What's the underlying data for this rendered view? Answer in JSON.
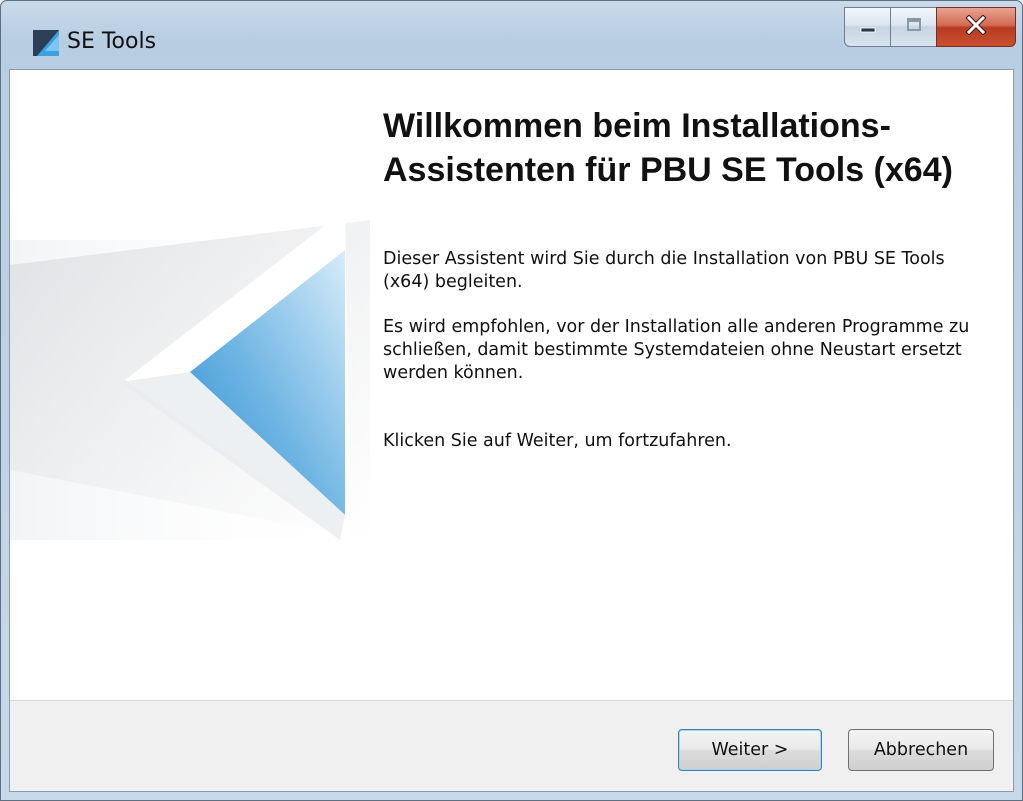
{
  "window": {
    "title": "SE Tools"
  },
  "content": {
    "heading": "Willkommen beim Installations-\nAssistenten für PBU SE Tools (x64)",
    "paragraphs": [
      "Dieser Assistent wird Sie durch die Installation von PBU SE Tools (x64) begleiten.",
      "Es wird empfohlen, vor der Installation alle anderen Programme zu schließen, damit bestimmte Systemdateien ohne Neustart ersetzt werden können.",
      "Klicken Sie auf Weiter, um fortzufahren."
    ]
  },
  "buttons": {
    "next": "Weiter >",
    "cancel": "Abbrechen"
  },
  "icons": {
    "app": "installer-chevron-icon",
    "minimize": "minimize-icon",
    "maximize": "maximize-icon",
    "close": "close-icon"
  },
  "colors": {
    "accent": "#3a9ad9",
    "close_button": "#c9502f"
  }
}
